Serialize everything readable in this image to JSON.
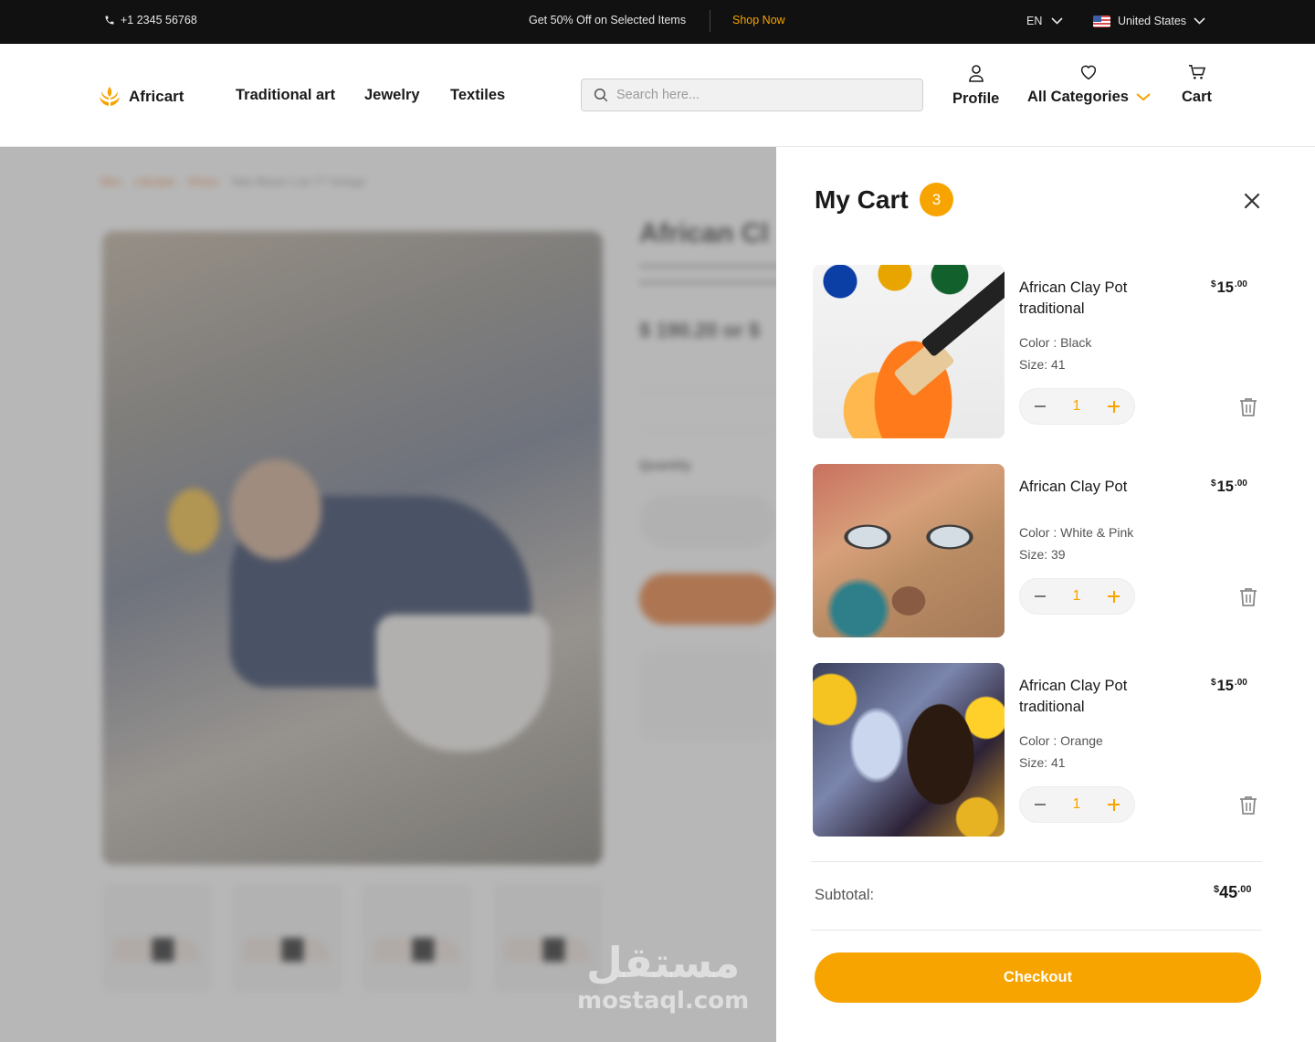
{
  "topbar": {
    "phone": "+1 2345 56768",
    "promo": "Get 50% Off on Selected Items",
    "shop_now": "Shop Now",
    "language": "EN",
    "country": "United States"
  },
  "header": {
    "logo": "Africart",
    "nav": [
      "Traditional art",
      "Jewelry",
      "Textiles"
    ],
    "search_placeholder": "Search here...",
    "profile": "Profile",
    "categories": "All Categories",
    "cart": "Cart"
  },
  "background": {
    "breadcrumb": [
      "Men",
      "Lifestyle",
      "Shoes",
      "Nike Blazer Low 77 Vintage"
    ],
    "title": "African Cl",
    "price": "$ 190.20 or $",
    "quantity_label": "Quantity"
  },
  "cart": {
    "title": "My Cart",
    "count": "3",
    "items": [
      {
        "name": "African Clay Pot traditional",
        "price_symbol": "$",
        "price_whole": "15",
        "price_cents": ".00",
        "color": "Color : Black",
        "size": "Size: 41",
        "qty": "1"
      },
      {
        "name": "African Clay Pot",
        "price_symbol": "$",
        "price_whole": "15",
        "price_cents": ".00",
        "color": "Color : White & Pink",
        "size": "Size: 39",
        "qty": "1"
      },
      {
        "name": "African Clay Pot traditional",
        "price_symbol": "$",
        "price_whole": "15",
        "price_cents": ".00",
        "color": "Color : Orange",
        "size": "Size: 41",
        "qty": "1"
      }
    ],
    "subtotal_label": "Subtotal:",
    "subtotal_symbol": "$",
    "subtotal_whole": "45",
    "subtotal_cents": ".00",
    "checkout": "Checkout"
  },
  "watermark": {
    "arabic": "مستقل",
    "latin": "mostaql.com"
  },
  "colors": {
    "accent": "#f7a400",
    "topbar": "#111111",
    "breadcrumb": "#e07a3a"
  }
}
